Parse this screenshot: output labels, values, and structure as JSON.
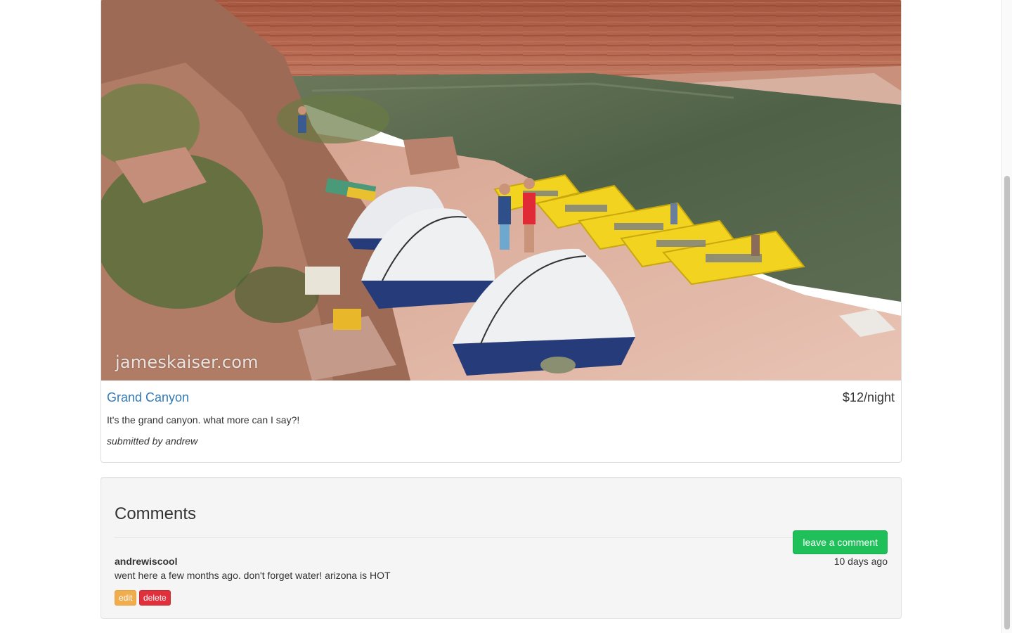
{
  "campground": {
    "name": "Grand Canyon",
    "price": "$12/night",
    "description": "It's the grand canyon. what more can I say?!",
    "submitted_by": "submitted by andrew",
    "image_watermark": "jameskaiser.com"
  },
  "comments_section": {
    "heading": "Comments",
    "leave_comment_label": "leave a comment",
    "comments": [
      {
        "author": "andrewiscool",
        "time_ago": "10 days ago",
        "text": "went here a few months ago. don't forget water! arizona is HOT",
        "edit_label": "edit",
        "delete_label": "delete"
      }
    ]
  },
  "colors": {
    "link": "#337ab7",
    "success": "#1fc05a",
    "warning": "#f0ad4e",
    "danger": "#e0303e"
  }
}
